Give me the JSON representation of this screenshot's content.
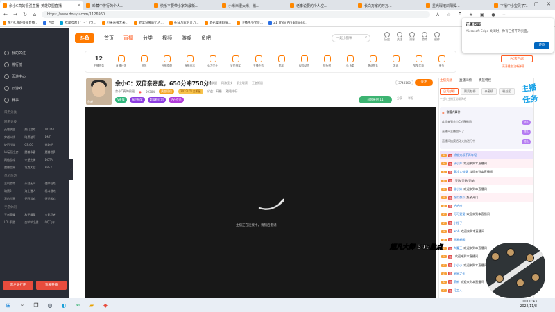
{
  "browser": {
    "tabs": [
      {
        "label": "余小C真的很强直播_英雄联盟直播",
        "active": true
      },
      {
        "label": "珍藏中排行的个人...",
        "active": false
      },
      {
        "label": "快乐不要带小家的最新...",
        "active": false
      },
      {
        "label": "小米米很大米，猪...",
        "active": false
      },
      {
        "label": "老李说要的个人空...",
        "active": false
      },
      {
        "label": "长白万家的万万...",
        "active": false
      },
      {
        "label": "星光璨璀斜阳鬓...",
        "active": false
      },
      {
        "label": "下播中小宝贝了...",
        "active": false
      },
      {
        "label": "21 They Are Billions...",
        "active": false
      }
    ],
    "url": "https://www.douyu.com/1126960",
    "bookmarks": [
      "余小C真的很强直播...",
      "百度",
      "哔哩哔哩 ( ゜- ゜)つ...",
      "小米米很大米...",
      "老李说要的个人...",
      "长白万家的万万...",
      "星光璨璀斜阳...",
      "下播中小宝贝...",
      "21 They Are Billions..."
    ]
  },
  "edge_popup": {
    "title": "还原页面",
    "desc": "Microsoft Edge 关闭时，你有已打开的页面。",
    "button": "还原"
  },
  "sidebar": {
    "items": [
      "我的关注",
      "排行榜",
      "页游中心",
      "云游戏",
      "赛事"
    ],
    "section1": "常用分类",
    "section2": "网游竞技",
    "grid1": [
      "英雄联盟",
      "热门游戏",
      "DOTA2",
      "穿越火线",
      "暗黑破坏",
      "DNF",
      "炉石传说",
      "CS:GO",
      "逃跑吧",
      "lol云顶之弈",
      "魔兽争霸",
      "魔兽世界",
      "网络游戏",
      "守望先锋",
      "DOTA",
      "魔兽世界",
      "坦克大战",
      "APEX"
    ],
    "section3": "单机热游",
    "grid2": [
      "主机游戏",
      "永劫无间",
      "使命召唤",
      "暗黑3",
      "海上猎人",
      "格斗游戏",
      "我的世界",
      "怀旧游戏",
      "怀旧游戏"
    ],
    "section4": "手游休闲",
    "grid3": [
      "王者荣耀",
      "和平精英",
      "火影忍者",
      "LOL手游",
      "金铲铲之战",
      "QQ飞车"
    ],
    "btn_client": "客户端打开",
    "btn_record": "我要开播",
    "collapse": "‹"
  },
  "header": {
    "logo": "斗鱼",
    "nav": [
      "首页",
      "直播",
      "分类",
      "视频",
      "游戏",
      "鱼吧"
    ],
    "search_placeholder": "一起小猫咪",
    "user_icons": [
      "历史",
      "关注",
      "消息",
      "游戏",
      "创作"
    ]
  },
  "categories": {
    "count": "12",
    "count_label": "主播任务",
    "items": [
      "直播开关",
      "鱼吧",
      "开播提醒",
      "直播日志",
      "火力全开",
      "全民抽奖",
      "主播任务",
      "酷车",
      "视频动态",
      "排行榜",
      "小飞碟",
      "赠送鱼丸",
      "发现",
      "兔兔比赛",
      "更多"
    ],
    "pc_app": "PC客户端",
    "pc_sub": "高清播放 流畅弹幕"
  },
  "streamer": {
    "title": "余小C：双倍亲密度，650分冲750分!",
    "tags": [
      "英雄联盟",
      "网游竞技",
      "职业联赛",
      "王者撕鲨"
    ],
    "name": "余小C真的很强",
    "rank": "69384",
    "level_tag": "黄金段位",
    "badge": "2022LOL全明星",
    "report": "公会：开播",
    "stats": "观看排行",
    "avatar_label": "鱼吧",
    "pills": [
      "V贵族",
      "福利抽奖",
      "超级粉丝团",
      "钻石会员"
    ],
    "count": "3744160",
    "follow_label": "关注",
    "fav_label": "可领亲密 11",
    "share_labels": [
      "分享",
      "举报"
    ]
  },
  "video": {
    "status": "主播正在连接中，请稍后重试"
  },
  "right_panel": {
    "tabs1": [
      "主播贡献",
      "直播间榜",
      "贵族特权"
    ],
    "tabs2": [
      "日贡献榜",
      "周贡献榜",
      "亲密榜",
      "粉丝团"
    ],
    "banner": "一起与主播互动聊天吧",
    "hot_title": "帝国大事件",
    "hot_rows": [
      {
        "text": "欢迎来到余小C的直播间",
        "badge": "送礼"
      },
      {
        "text": "直播间主播加入了...",
        "badge": "送礼"
      },
      {
        "text": "直播间抽奖活动火热进行中",
        "badge": "送礼"
      }
    ],
    "gift_logo": "主播任务"
  },
  "chat": [
    {
      "lv": "36",
      "user": "忧郁大叔不再年轻",
      "text": "",
      "style": "purple"
    },
    {
      "lv": "24",
      "user": "汤小炸",
      "text": "欢迎来到本直播间",
      "style": "hl"
    },
    {
      "lv": "23",
      "user": "高冷大帅哥",
      "text": "欢迎来到本直播间",
      "style": ""
    },
    {
      "lv": "25",
      "user": "",
      "text": "天呐 天呐  天呐",
      "style": "hl"
    },
    {
      "lv": "20",
      "user": "猫小妹",
      "text": "欢迎来到本直播间",
      "style": ""
    },
    {
      "lv": "18",
      "user": "吃瓜群众",
      "text": "赶紧开门",
      "style": "hl"
    },
    {
      "lv": "18",
      "user": "哈哈哈",
      "text": "",
      "style": ""
    },
    {
      "lv": "17",
      "user": "可可爱爱",
      "text": "欢迎来到本直播间",
      "style": ""
    },
    {
      "lv": "17",
      "user": "小橙子",
      "text": "",
      "style": ""
    },
    {
      "lv": "16",
      "user": "whb",
      "text": "欢迎来到本直播间",
      "style": ""
    },
    {
      "lv": "16",
      "user": "网易新闻",
      "text": "",
      "style": ""
    },
    {
      "lv": "15",
      "user": "大魔王",
      "text": "欢迎来到本直播间",
      "style": ""
    },
    {
      "lv": "14",
      "user": "",
      "text": "欢迎来到本直播间",
      "style": ""
    },
    {
      "lv": "13",
      "user": "小小小",
      "text": "欢迎来到本直播间",
      "style": ""
    },
    {
      "lv": "13",
      "user": "星星之火",
      "text": "",
      "style": ""
    },
    {
      "lv": "12",
      "user": "萌新",
      "text": "欢迎来到本直播间",
      "style": ""
    },
    {
      "lv": "12",
      "user": "打工人",
      "text": "",
      "style": ""
    }
  ],
  "overlay": {
    "text": "超凡大师 549胜点"
  },
  "taskbar": {
    "time": "10:00:43",
    "date": "2022/11/8"
  }
}
